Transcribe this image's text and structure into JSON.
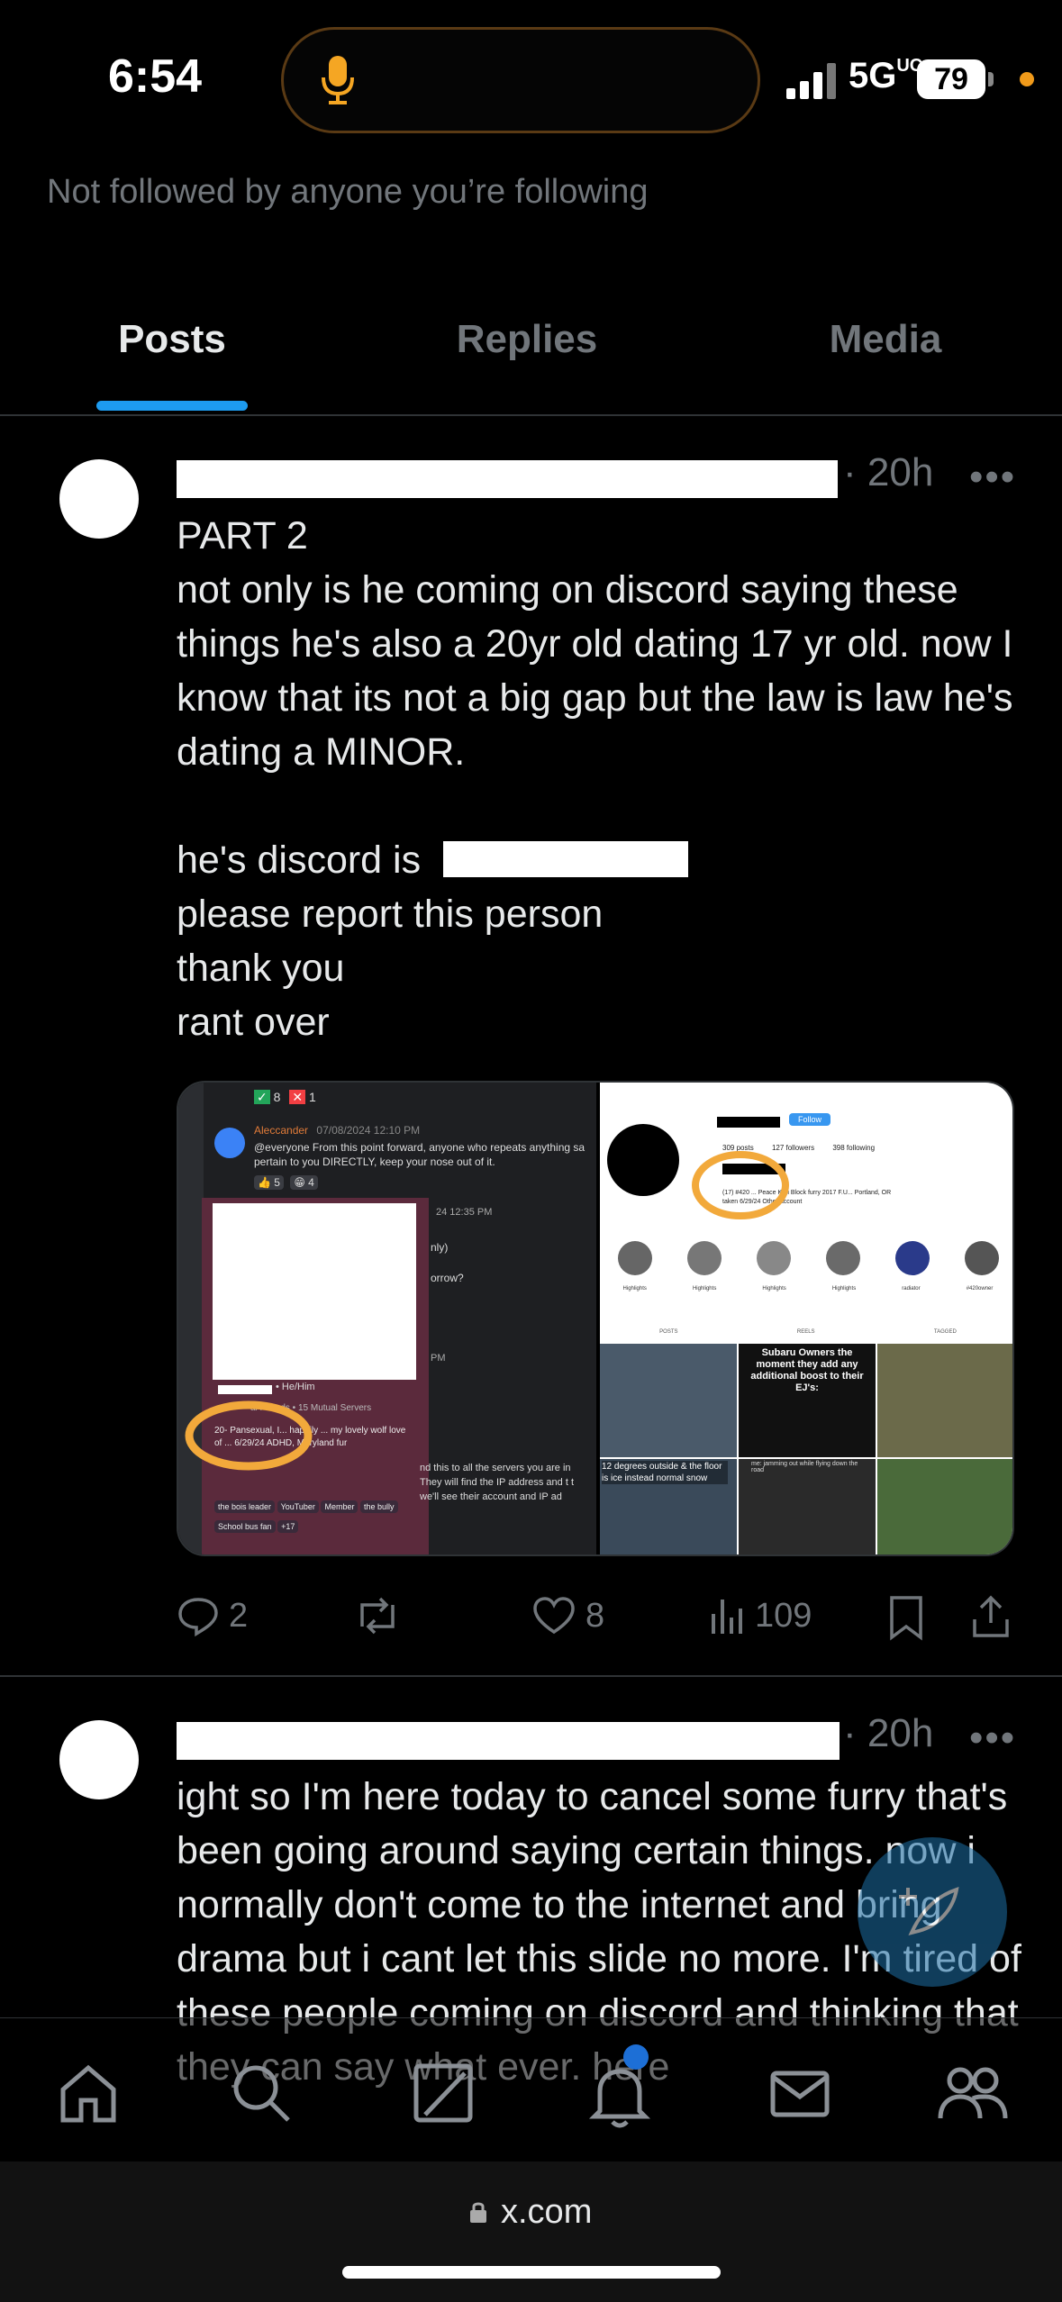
{
  "status_bar": {
    "time": "6:54",
    "network": "5G",
    "network_sup": "UC",
    "battery": "79"
  },
  "profile": {
    "not_followed_text": "Not followed by anyone you’re following"
  },
  "tabs": [
    {
      "label": "Posts",
      "active": true
    },
    {
      "label": "Replies",
      "active": false
    },
    {
      "label": "Media",
      "active": false
    }
  ],
  "posts": [
    {
      "time": "· 20h",
      "more": "•••",
      "text_part1": "PART 2\nnot only is he coming on discord saying these things he's also a 20yr old dating 17 yr old. now I know that its not a big gap but the law is law he's dating a MINOR.",
      "text_discord_prefix": "he's discord is",
      "text_part2": "please report this person\nthank you\nrant over",
      "media": {
        "left": {
          "reactions_top": [
            "8",
            "1"
          ],
          "user": "Aleccander",
          "timestamp": "07/08/2024 12:10 PM",
          "message": "@everyone From this point forward, anyone who repeats anything sa pertain to you DIRECTLY, keep your nose out of it.",
          "reactions": [
            "5",
            "4"
          ],
          "msg_time": "24 12:35 PM",
          "snippet1": "nly)",
          "snippet2": "orrow?",
          "snippet3": "PM",
          "pronouns": "• He/Him",
          "friends": "al Friends • 15 Mutual Servers",
          "bio": "20- Pansexual, I... happily ... my lovely wolf love of ... 6/29/24 ADHD, Maryland fur",
          "ip_text": "nd this to all the servers you are in They will find the IP address and t t we'll see their account and IP ad",
          "roles": [
            "the bois leader",
            "YouTuber",
            "Member",
            "the bully",
            "School bus fan",
            "+17"
          ]
        },
        "right": {
          "follow": "Follow",
          "posts": "309 posts",
          "followers": "127 followers",
          "following": "398 following",
          "bio": "(17) #420 ... Peace Kari Block furry 2017 F.U... Portland, OR taken 6/29/24 Other account",
          "highlights": [
            "Highlights",
            "Highlights",
            "Highlights",
            "Highlights",
            "radiator",
            "#420owner"
          ],
          "tabs": [
            "POSTS",
            "REELS",
            "TAGGED"
          ],
          "post1": "Subaru Owners the moment they add any additional boost to their EJ's:",
          "post2": "12 degrees outside & the floor is ice instead normal snow",
          "post3": "me: jamming out while flying down the road"
        }
      },
      "stats": {
        "replies": "2",
        "reposts": "",
        "likes": "8",
        "views": "109"
      }
    },
    {
      "time": "· 20h",
      "more": "•••",
      "text": "ight so I'm here today to cancel some furry that's been going around saying certain things. now i normally don't come to the internet and bring drama but i cant let this slide no more. I'm tired of these people coming on discord and thinking that they can say what ever. here"
    }
  ],
  "bottom_nav": [
    "home-icon",
    "search-icon",
    "grok-icon",
    "notifications-icon",
    "messages-icon",
    "communities-icon"
  ],
  "url_bar": {
    "url": "x.com"
  },
  "colors": {
    "accent": "#1d9bf0",
    "background": "#000000",
    "muted": "#71767b",
    "highlight_circle": "#f2a93b"
  }
}
